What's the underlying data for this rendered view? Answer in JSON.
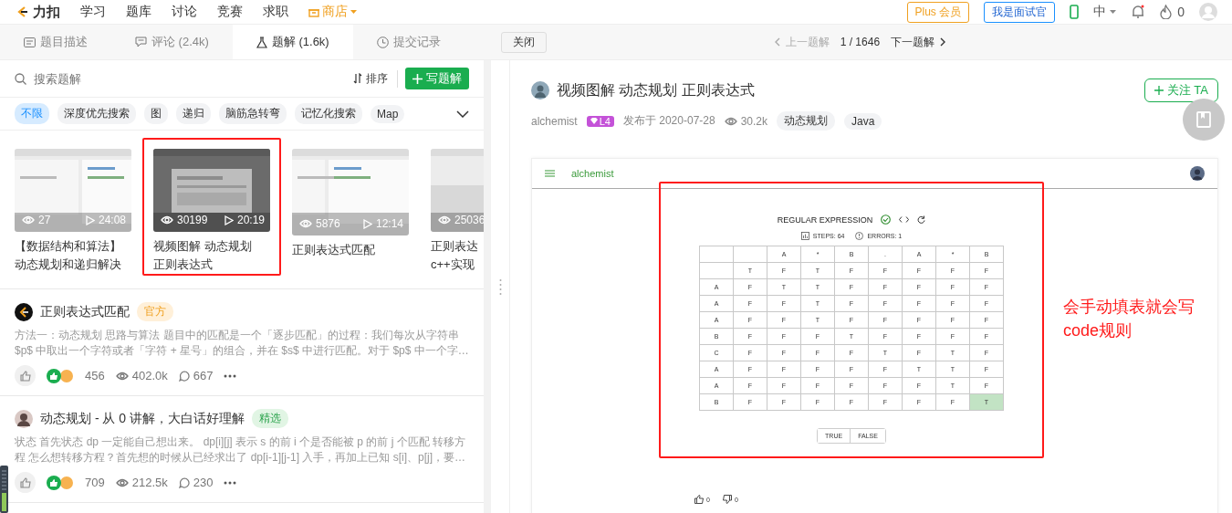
{
  "nav": {
    "logo": "力扣",
    "items": [
      {
        "label": "学习",
        "kind": "link"
      },
      {
        "label": "题库",
        "kind": "link"
      },
      {
        "label": "讨论",
        "kind": "link"
      },
      {
        "label": "竞赛",
        "kind": "link"
      },
      {
        "label": "求职",
        "kind": "link"
      },
      {
        "label": "商店",
        "kind": "store"
      }
    ],
    "plus": "Plus 会员",
    "interviewer": "我是面试官",
    "language": "中",
    "points": "0"
  },
  "tabs": [
    {
      "label": "题目描述",
      "kind": "description",
      "selected": false
    },
    {
      "label": "评论 (2.4k)",
      "kind": "comments",
      "selected": false
    },
    {
      "label": "题解 (1.6k)",
      "kind": "solutions",
      "selected": true
    },
    {
      "label": "提交记录",
      "kind": "submissions",
      "selected": false
    }
  ],
  "close": "关闭",
  "pager": {
    "prev": "上一题解",
    "prev_disabled": true,
    "position": "1 / 1646",
    "next": "下一题解"
  },
  "search": {
    "placeholder": "搜索题解"
  },
  "sort": "排序",
  "write": "写题解",
  "tags": [
    {
      "label": "不限",
      "selected": true
    },
    {
      "label": "深度优先搜索",
      "selected": false
    },
    {
      "label": "图",
      "selected": false
    },
    {
      "label": "递归",
      "selected": false
    },
    {
      "label": "脑筋急转弯",
      "selected": false
    },
    {
      "label": "记忆化搜索",
      "selected": false
    },
    {
      "label": "Map",
      "selected": false
    }
  ],
  "videos": [
    {
      "kind": "picture",
      "views": "27",
      "duration": "24:08",
      "title_lines": [
        "【数据结构和算法】",
        "动态规划和递归解决"
      ],
      "highlighted": false
    },
    {
      "kind": "picture",
      "views": "30199",
      "duration": "20:19",
      "title_lines": [
        "视频图解 动态规划",
        "正则表达式"
      ],
      "highlighted": true
    },
    {
      "kind": "picture",
      "views": "5876",
      "duration": "12:14",
      "title_lines": [
        "正则表达式匹配"
      ],
      "highlighted": false
    },
    {
      "kind": "picture",
      "views": "25036",
      "title_lines": [
        "正则表达",
        "c++实现"
      ],
      "highlighted": false
    }
  ],
  "solutions": [
    {
      "kind": "official",
      "title": "正则表达式匹配",
      "badge": {
        "text": "官方",
        "kind": "official"
      },
      "summary": "方法一：动态规划 思路与算法 题目中的匹配是一个「逐步匹配」的过程：我们每次从字符串 $p$ 中取出一个字符或者「字符 + 星号」的组合，并在 $s$ 中进行匹配。对于 $p$ 中一个字…",
      "likes": "456",
      "views": "402.0k",
      "comments": "667"
    },
    {
      "kind": "user",
      "title": "动态规划 - 从 0 讲解，大白话好理解",
      "badge": {
        "text": "精选",
        "kind": "featured"
      },
      "summary": "状态 首先状态 dp 一定能自己想出来。 dp[i][j] 表示 s 的前 i 个是否能被 p 的前 j 个匹配 转移方程 怎么想转移方程？首先想的时候从已经求出了 dp[i-1][j-1] 入手，再加上已知 s[i]、p[j]，要…",
      "likes": "709",
      "views": "212.5k",
      "comments": "230"
    }
  ],
  "article": {
    "title": "视频图解 动态规划 正则表达式",
    "author": "alchemist",
    "level": "L4",
    "date": "发布于 2020-07-28",
    "views": "30.2k",
    "tags": [
      "动态规划",
      "Java"
    ],
    "follow": "关注 TA"
  },
  "video": {
    "user": "alchemist",
    "heading": "REGULAR EXPRESSION",
    "steps": "STEPS: 64",
    "errors": "ERRORS: 1",
    "columns": [
      "",
      "A",
      "*",
      "B",
      ".",
      "A",
      "*",
      "B"
    ],
    "rows": [
      {
        "cells": [
          {
            "text": "T",
            "selected": false
          },
          {
            "text": "F",
            "selected": false
          },
          {
            "text": "T",
            "selected": false
          },
          {
            "text": "F",
            "selected": false
          },
          {
            "text": "F",
            "selected": false
          },
          {
            "text": "F",
            "selected": false
          },
          {
            "text": "F",
            "selected": false
          },
          {
            "text": "F",
            "selected": false
          }
        ]
      },
      {
        "label": "A",
        "cells": [
          {
            "text": "F",
            "selected": false
          },
          {
            "text": "T",
            "selected": false
          },
          {
            "text": "T",
            "selected": false
          },
          {
            "text": "F",
            "selected": false
          },
          {
            "text": "F",
            "selected": false
          },
          {
            "text": "F",
            "selected": false
          },
          {
            "text": "F",
            "selected": false
          },
          {
            "text": "F",
            "selected": false
          }
        ]
      },
      {
        "label": "A",
        "cells": [
          {
            "text": "F",
            "selected": false
          },
          {
            "text": "F",
            "selected": false
          },
          {
            "text": "T",
            "selected": false
          },
          {
            "text": "F",
            "selected": false
          },
          {
            "text": "F",
            "selected": false
          },
          {
            "text": "F",
            "selected": false
          },
          {
            "text": "F",
            "selected": false
          },
          {
            "text": "F",
            "selected": false
          }
        ]
      },
      {
        "label": "A",
        "cells": [
          {
            "text": "F",
            "selected": false
          },
          {
            "text": "F",
            "selected": false
          },
          {
            "text": "T",
            "selected": false
          },
          {
            "text": "F",
            "selected": false
          },
          {
            "text": "F",
            "selected": false
          },
          {
            "text": "F",
            "selected": false
          },
          {
            "text": "F",
            "selected": false
          },
          {
            "text": "F",
            "selected": false
          }
        ]
      },
      {
        "label": "B",
        "cells": [
          {
            "text": "F",
            "selected": false
          },
          {
            "text": "F",
            "selected": false
          },
          {
            "text": "F",
            "selected": false
          },
          {
            "text": "T",
            "selected": false
          },
          {
            "text": "F",
            "selected": false
          },
          {
            "text": "F",
            "selected": false
          },
          {
            "text": "F",
            "selected": false
          },
          {
            "text": "F",
            "selected": false
          }
        ]
      },
      {
        "label": "C",
        "cells": [
          {
            "text": "F",
            "selected": false
          },
          {
            "text": "F",
            "selected": false
          },
          {
            "text": "F",
            "selected": false
          },
          {
            "text": "F",
            "selected": false
          },
          {
            "text": "T",
            "selected": false
          },
          {
            "text": "F",
            "selected": false
          },
          {
            "text": "T",
            "selected": false
          },
          {
            "text": "F",
            "selected": false
          }
        ]
      },
      {
        "label": "A",
        "cells": [
          {
            "text": "F",
            "selected": false
          },
          {
            "text": "F",
            "selected": false
          },
          {
            "text": "F",
            "selected": false
          },
          {
            "text": "F",
            "selected": false
          },
          {
            "text": "F",
            "selected": false
          },
          {
            "text": "T",
            "selected": false
          },
          {
            "text": "T",
            "selected": false
          },
          {
            "text": "F",
            "selected": false
          }
        ]
      },
      {
        "label": "A",
        "cells": [
          {
            "text": "F",
            "selected": false
          },
          {
            "text": "F",
            "selected": false
          },
          {
            "text": "F",
            "selected": false
          },
          {
            "text": "F",
            "selected": false
          },
          {
            "text": "F",
            "selected": false
          },
          {
            "text": "F",
            "selected": false
          },
          {
            "text": "T",
            "selected": false
          },
          {
            "text": "F",
            "selected": false
          }
        ]
      },
      {
        "label": "B",
        "cells": [
          {
            "text": "F",
            "selected": false
          },
          {
            "text": "F",
            "selected": false
          },
          {
            "text": "F",
            "selected": false
          },
          {
            "text": "F",
            "selected": false
          },
          {
            "text": "F",
            "selected": false
          },
          {
            "text": "F",
            "selected": false
          },
          {
            "text": "F",
            "selected": false
          },
          {
            "text": "T",
            "selected": true
          }
        ]
      }
    ],
    "buttons": [
      "TRUE",
      "FALSE"
    ],
    "likes": "0",
    "dislikes": "0"
  },
  "annotation": "会手动填表就会写code规则"
}
